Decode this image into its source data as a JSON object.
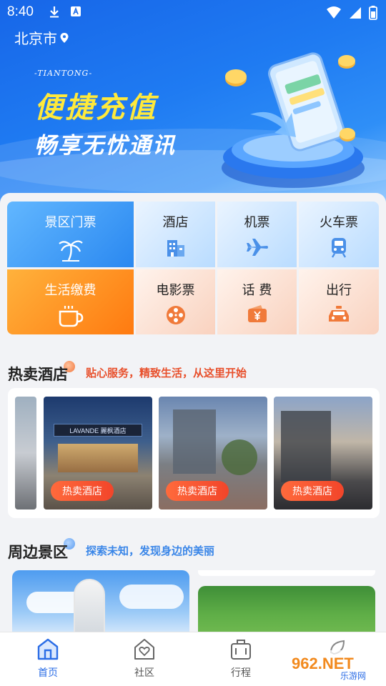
{
  "status_bar": {
    "time": "8:40"
  },
  "location": {
    "city": "北京市"
  },
  "banner": {
    "brand": "-TIANTONG-",
    "headline": "便捷充值",
    "subheadline": "畅享无忧通讯"
  },
  "services": {
    "scenic_tickets": "景区门票",
    "hotel": "酒店",
    "flight": "机票",
    "train": "火车票",
    "utilities": "生活缴费",
    "movie": "电影票",
    "phone_bill": "话 费",
    "travel": "出行"
  },
  "hot_hotels": {
    "title": "热卖酒店",
    "subtitle": "贴心服务，精致生活，从这里开始",
    "tag": "热卖酒店",
    "sign_text": "LAVANDE 麗枫酒店"
  },
  "nearby": {
    "title": "周边景区",
    "subtitle": "探索未知，发现身边的美丽"
  },
  "nav": {
    "home": "首页",
    "community": "社区",
    "trips": "行程"
  },
  "watermark": {
    "text": "962.NET",
    "sub": "乐游网"
  },
  "colors": {
    "accent_blue": "#2b6de6",
    "headline_yellow": "#ffe93b",
    "hot_red": "#e8502c",
    "nearby_blue": "#3a86e8"
  }
}
